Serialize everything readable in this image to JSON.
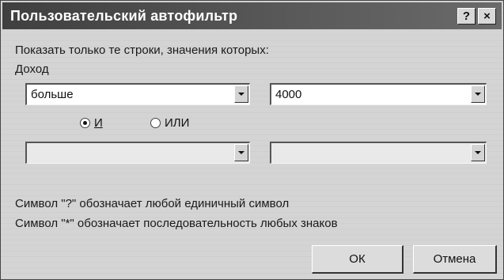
{
  "window": {
    "title": "Пользовательский автофильтр",
    "help_label": "?",
    "close_label": "×"
  },
  "prompt": "Показать только те строки, значения которых:",
  "field_name": "Доход",
  "condition1": {
    "operator": "больше",
    "value": "4000"
  },
  "logic": {
    "and_label": "И",
    "or_label": "ИЛИ",
    "selected": "and"
  },
  "condition2": {
    "operator": "",
    "value": ""
  },
  "hints": {
    "single": "Символ \"?\" обозначает любой единичный символ",
    "multi": "Символ \"*\" обозначает последовательность любых знаков"
  },
  "buttons": {
    "ok": "ОК",
    "cancel": "Отмена"
  }
}
